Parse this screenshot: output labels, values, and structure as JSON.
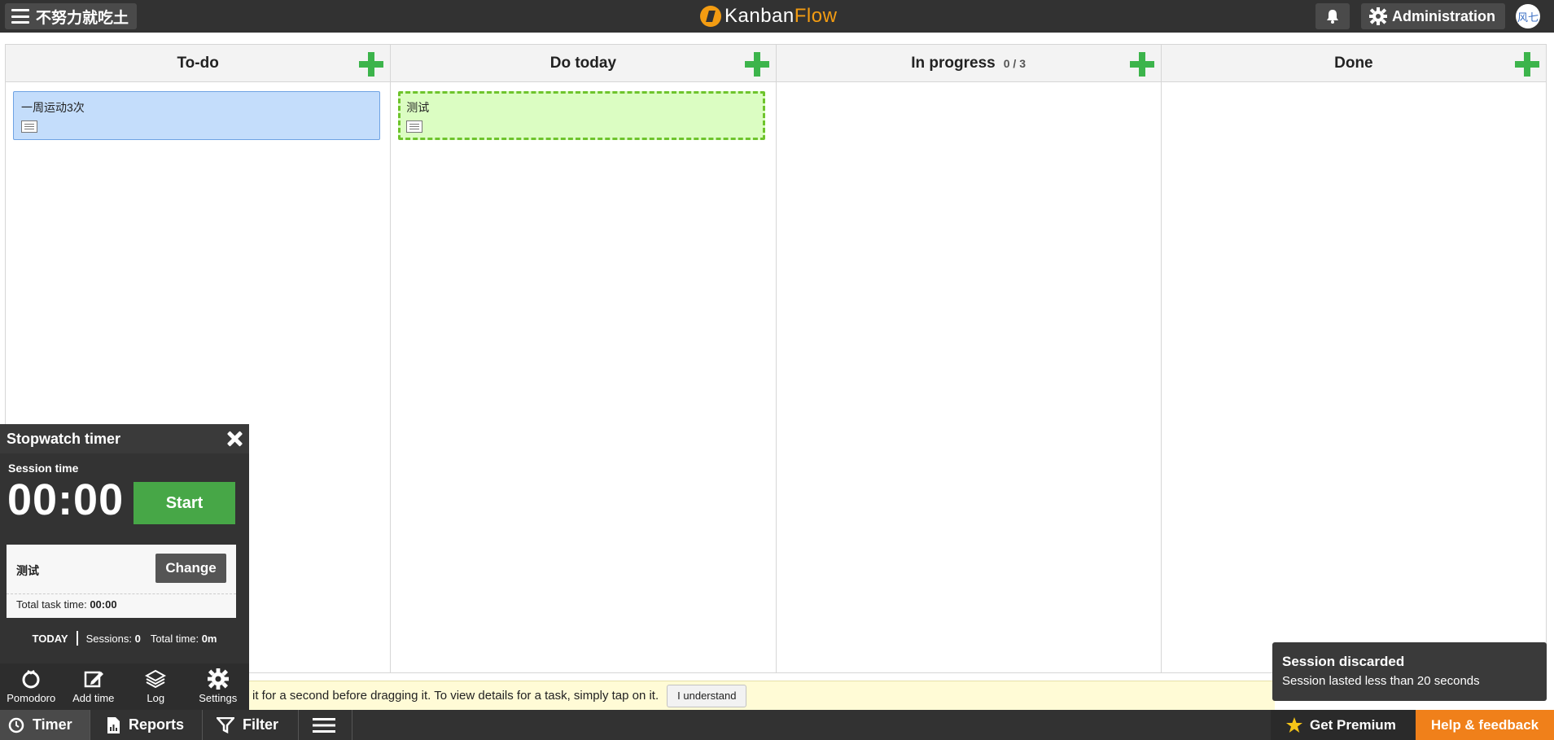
{
  "topbar": {
    "board_name": "不努力就吃土",
    "logo_part1": "Kanban",
    "logo_part2": "Flow",
    "admin_label": "Administration",
    "avatar_text": "风七",
    "accent_color": "#f39c12"
  },
  "columns": [
    {
      "title": "To-do",
      "wip": ""
    },
    {
      "title": "Do today",
      "wip": ""
    },
    {
      "title": "In progress",
      "wip": "0 / 3"
    },
    {
      "title": "Done",
      "wip": ""
    }
  ],
  "tasks": [
    {
      "column": "To-do",
      "title": "一周运动3次",
      "color": "#c4ddfb"
    },
    {
      "column": "Do today",
      "title": "测试",
      "color": "#dbfdc2"
    }
  ],
  "timer": {
    "title": "Stopwatch timer",
    "session_label": "Session time",
    "session_time": "00:00",
    "start_label": "Start",
    "task_name": "测试",
    "change_label": "Change",
    "total_task_label": "Total task time:",
    "total_task_value": "00:00",
    "today_label": "TODAY",
    "sessions_label": "Sessions:",
    "sessions_value": "0",
    "total_time_label": "Total time:",
    "total_time_value": "0m",
    "tools": [
      "Pomodoro",
      "Add time",
      "Log",
      "Settings"
    ]
  },
  "hint": {
    "text": "it for a second before dragging it. To view details for a task, simply tap on it.",
    "button": "I understand"
  },
  "bottombar": {
    "timer": "Timer",
    "reports": "Reports",
    "filter": "Filter",
    "premium": "Get Premium",
    "help": "Help & feedback"
  },
  "toast": {
    "title": "Session discarded",
    "message": "Session lasted less than 20 seconds"
  }
}
